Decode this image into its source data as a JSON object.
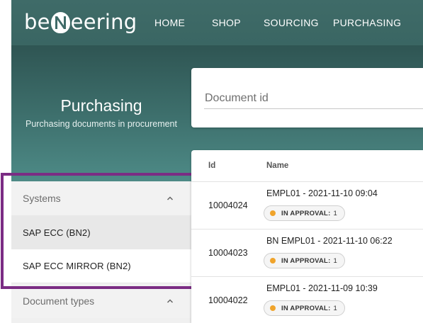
{
  "brand": {
    "logo_left": "be",
    "logo_right": "eering"
  },
  "nav": {
    "items": [
      "HOME",
      "SHOP",
      "SOURCING",
      "PURCHASING"
    ]
  },
  "hero": {
    "title": "Purchasing",
    "subtitle": "Purchasing documents in procurement"
  },
  "search": {
    "placeholder": "Document id"
  },
  "filters": {
    "systems": {
      "title": "Systems",
      "items": [
        "SAP ECC (BN2)",
        "SAP ECC MIRROR (BN2)"
      ],
      "selected": "SAP ECC (BN2)"
    },
    "document_types": {
      "title": "Document types"
    }
  },
  "table": {
    "headers": [
      "Id",
      "Name"
    ],
    "rows": [
      {
        "id": "10004024",
        "name": "EMPL01 - 2021-11-10 09:04",
        "status_label": "IN APPROVAL:",
        "status_count": "1"
      },
      {
        "id": "10004023",
        "name": "BN EMPL01 - 2021-11-10 06:22",
        "status_label": "IN APPROVAL:",
        "status_count": "1"
      },
      {
        "id": "10004022",
        "name": "EMPL01 - 2021-11-09 10:39",
        "status_label": "IN APPROVAL:",
        "status_count": "1"
      }
    ]
  },
  "colors": {
    "navbar": "#3f6b68",
    "status_dot": "#f0a42b",
    "highlight_border": "#7b2c84"
  }
}
